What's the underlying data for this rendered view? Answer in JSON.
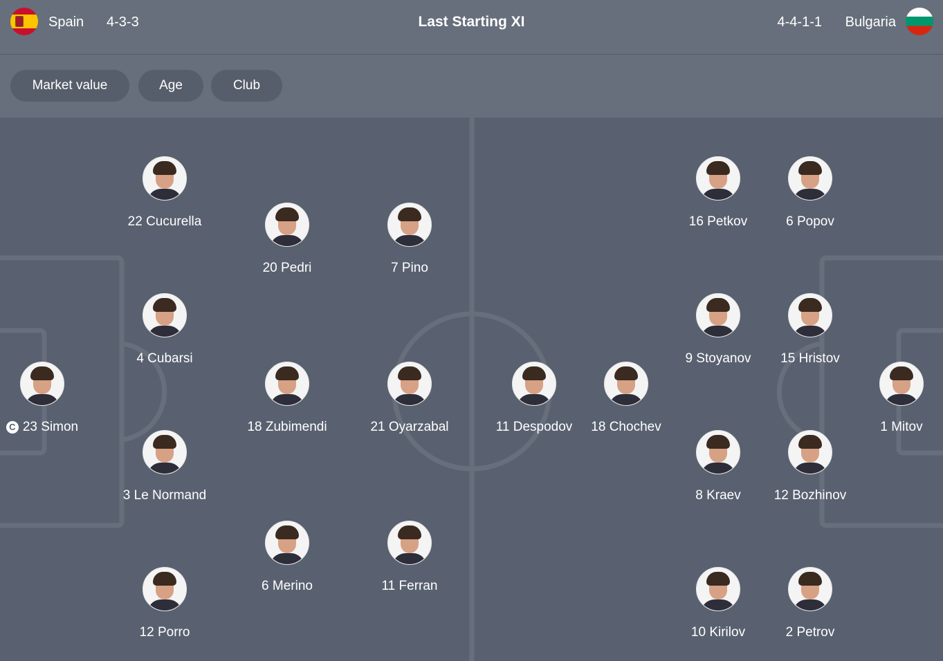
{
  "header": {
    "title": "Last Starting XI",
    "home": {
      "name": "Spain",
      "formation": "4-3-3",
      "flag_icon": "spain-flag-icon"
    },
    "away": {
      "name": "Bulgaria",
      "formation": "4-4-1-1",
      "flag_icon": "bulgaria-flag-icon"
    }
  },
  "filters": {
    "market_value": "Market value",
    "age": "Age",
    "club": "Club"
  },
  "home_players": [
    {
      "label": "22 Cucurella"
    },
    {
      "label": "20 Pedri"
    },
    {
      "label": "7 Pino"
    },
    {
      "label": "4 Cubarsi"
    },
    {
      "label": "23 Simon",
      "captain_badge": "C"
    },
    {
      "label": "18 Zubimendi"
    },
    {
      "label": "21 Oyarzabal"
    },
    {
      "label": "3 Le Normand"
    },
    {
      "label": "6 Merino"
    },
    {
      "label": "11 Ferran"
    },
    {
      "label": "12 Porro"
    }
  ],
  "away_players": [
    {
      "label": "16 Petkov"
    },
    {
      "label": "6 Popov"
    },
    {
      "label": "9 Stoyanov"
    },
    {
      "label": "15 Hristov"
    },
    {
      "label": "11 Despodov"
    },
    {
      "label": "18 Chochev"
    },
    {
      "label": "1 Mitov"
    },
    {
      "label": "8 Kraev"
    },
    {
      "label": "12 Bozhinov"
    },
    {
      "label": "10 Kirilov"
    },
    {
      "label": "2 Petrov"
    }
  ],
  "colors": {
    "pitch": "#596170",
    "header": "#666f7b",
    "chip": "#565e6b",
    "lines": "#676f7c"
  }
}
